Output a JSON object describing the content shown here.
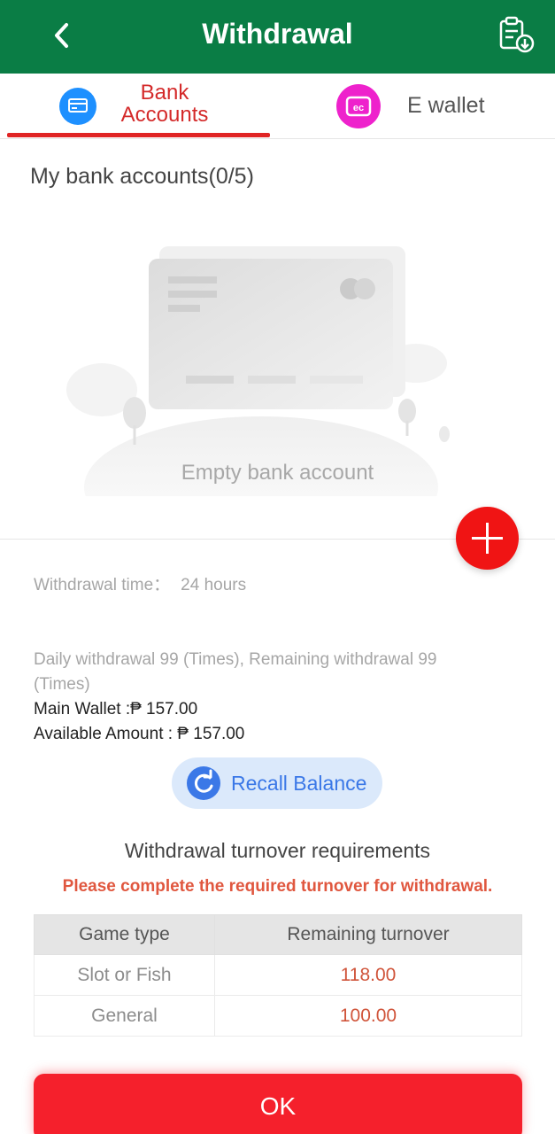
{
  "header": {
    "title": "Withdrawal",
    "back_icon": "chevron-left-icon",
    "record_icon": "clipboard-download-icon"
  },
  "tabs": [
    {
      "label": "Bank Accounts",
      "icon": "bank-card-icon",
      "active": true
    },
    {
      "label": "E wallet",
      "icon": "e-wallet-icon",
      "active": false
    }
  ],
  "bank": {
    "section_title": "My bank accounts(0/5)",
    "empty_text": "Empty bank account",
    "add_icon": "plus-icon"
  },
  "info": {
    "time_label": "Withdrawal time：",
    "time_value": "24 hours",
    "daily_text": "Daily withdrawal 99 (Times), Remaining withdrawal 99 (Times)",
    "main_wallet": "Main Wallet :₱ 157.00",
    "available": "Available Amount : ₱ 157.00"
  },
  "recall": {
    "label": "Recall Balance",
    "icon": "refresh-icon"
  },
  "turnover": {
    "title": "Withdrawal turnover requirements",
    "warning": "Please complete the required turnover for withdrawal.",
    "headers": [
      "Game type",
      "Remaining turnover"
    ],
    "rows": [
      {
        "type": "Slot or Fish",
        "amount": "118.00"
      },
      {
        "type": "General",
        "amount": "100.00"
      }
    ]
  },
  "ok_label": "OK",
  "colors": {
    "header_bg": "#0a7d45",
    "accent_red": "#f01414",
    "recall_blue": "#3b78e7"
  }
}
